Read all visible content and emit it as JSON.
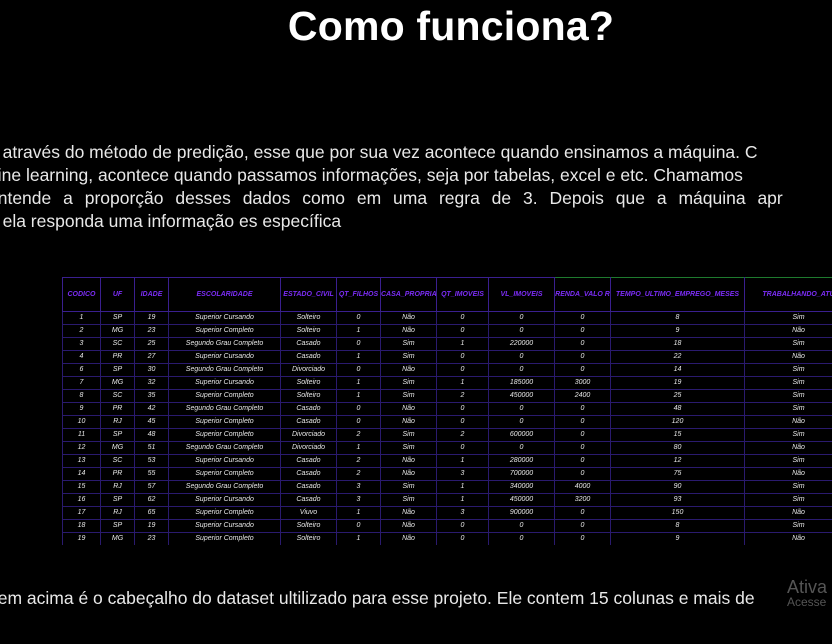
{
  "slide": {
    "title": "Como funciona?",
    "paragraph_lines": [
      "a através do método de predição, esse que por sua vez acontece quando ensinamos a máquina. C",
      "hine learning, acontece quando passamos informações, seja por tabelas, excel e etc. Chamamos",
      " entende a proporção desses dados como em uma regra de 3. Depois que a máquina apr",
      "e ela responda uma informação es específica"
    ],
    "bottom_text": "gem acima é o cabeçalho do dataset ultilizado para esse projeto. Ele contem 15 colunas e mais de",
    "watermark_line1": "Ativa",
    "watermark_line2": "Acesse"
  },
  "table": {
    "headers": [
      "CODICO",
      "UF",
      "IDADE",
      "ESCOLARIDADE",
      "ESTADO_CIVIL",
      "QT_FILHOS",
      "CASA_PROPRIA",
      "QT_IMOVEIS",
      "VL_IMOVEIS",
      "RENDA_VALO R",
      "TEMPO_ULTIMO_EMPREGO_MESES",
      "TRABALHANDO_ATU"
    ],
    "rows": [
      [
        "1",
        "SP",
        "19",
        "Superior Cursando",
        "Solteiro",
        "0",
        "Não",
        "0",
        "0",
        "0",
        "8",
        "Sim"
      ],
      [
        "2",
        "MG",
        "23",
        "Superior Completo",
        "Solteiro",
        "1",
        "Não",
        "0",
        "0",
        "0",
        "9",
        "Não"
      ],
      [
        "3",
        "SC",
        "25",
        "Segundo Grau Completo",
        "Casado",
        "0",
        "Sim",
        "1",
        "220000",
        "0",
        "18",
        "Sim"
      ],
      [
        "4",
        "PR",
        "27",
        "Superior Cursando",
        "Casado",
        "1",
        "Sim",
        "0",
        "0",
        "0",
        "22",
        "Não"
      ],
      [
        "6",
        "SP",
        "30",
        "Segundo Grau Completo",
        "Divorciado",
        "0",
        "Não",
        "0",
        "0",
        "0",
        "14",
        "Sim"
      ],
      [
        "7",
        "MG",
        "32",
        "Superior Cursando",
        "Solteiro",
        "1",
        "Sim",
        "1",
        "185000",
        "3000",
        "19",
        "Sim"
      ],
      [
        "8",
        "SC",
        "35",
        "Superior Completo",
        "Solteiro",
        "1",
        "Sim",
        "2",
        "450000",
        "2400",
        "25",
        "Sim"
      ],
      [
        "9",
        "PR",
        "42",
        "Segundo Grau Completo",
        "Casado",
        "0",
        "Não",
        "0",
        "0",
        "0",
        "48",
        "Sim"
      ],
      [
        "10",
        "RJ",
        "45",
        "Superior Completo",
        "Casado",
        "0",
        "Não",
        "0",
        "0",
        "0",
        "120",
        "Não"
      ],
      [
        "11",
        "SP",
        "48",
        "Superior Completo",
        "Divorciado",
        "2",
        "Sim",
        "2",
        "600000",
        "0",
        "15",
        "Sim"
      ],
      [
        "12",
        "MG",
        "51",
        "Segundo Grau Completo",
        "Divorciado",
        "1",
        "Sim",
        "0",
        "0",
        "0",
        "80",
        "Não"
      ],
      [
        "13",
        "SC",
        "53",
        "Superior Cursando",
        "Casado",
        "2",
        "Não",
        "1",
        "280000",
        "0",
        "12",
        "Sim"
      ],
      [
        "14",
        "PR",
        "55",
        "Superior Completo",
        "Casado",
        "2",
        "Não",
        "3",
        "700000",
        "0",
        "75",
        "Não"
      ],
      [
        "15",
        "RJ",
        "57",
        "Segundo Grau Completo",
        "Casado",
        "3",
        "Sim",
        "1",
        "340000",
        "4000",
        "90",
        "Sim"
      ],
      [
        "16",
        "SP",
        "62",
        "Superior Cursando",
        "Casado",
        "3",
        "Sim",
        "1",
        "450000",
        "3200",
        "93",
        "Sim"
      ],
      [
        "17",
        "RJ",
        "65",
        "Superior Completo",
        "Viuvo",
        "1",
        "Não",
        "3",
        "900000",
        "0",
        "150",
        "Não"
      ],
      [
        "18",
        "SP",
        "19",
        "Superior Cursando",
        "Solteiro",
        "0",
        "Não",
        "0",
        "0",
        "0",
        "8",
        "Sim"
      ],
      [
        "19",
        "MG",
        "23",
        "Superior Completo",
        "Solteiro",
        "1",
        "Não",
        "0",
        "0",
        "0",
        "9",
        "Não"
      ]
    ]
  },
  "colors": {
    "background": "#000000",
    "header_text": "#7b2cf5",
    "grid_lines": "#2a1a6e"
  }
}
